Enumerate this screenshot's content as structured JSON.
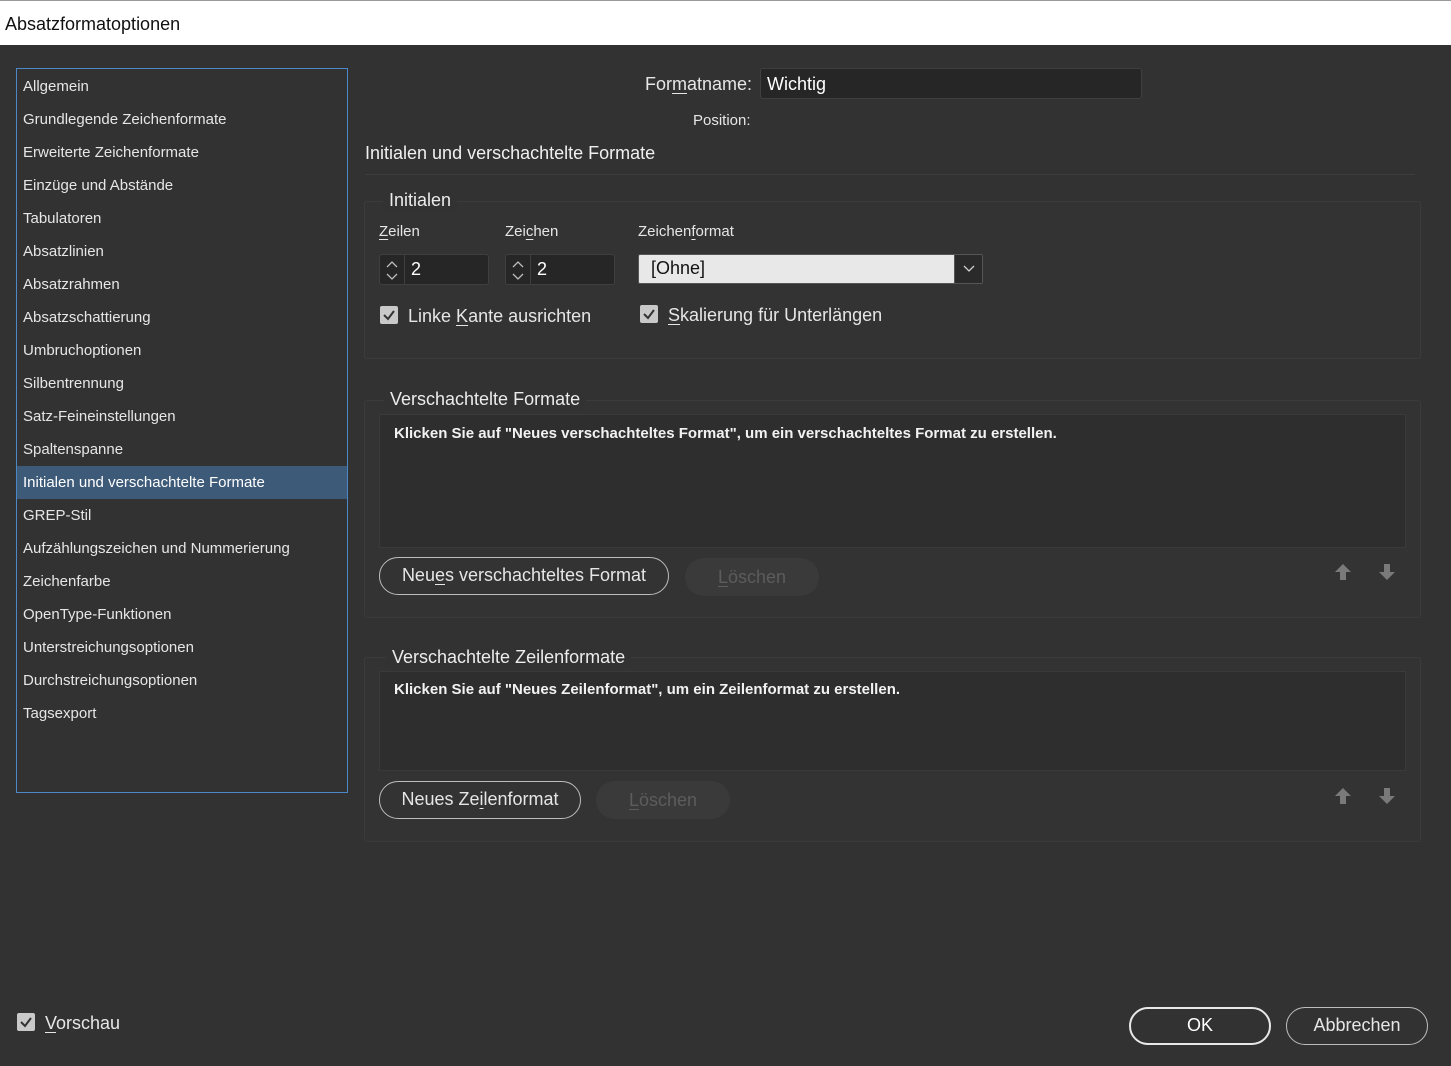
{
  "window": {
    "title": "Absatzformatoptionen"
  },
  "sidebar": {
    "items": [
      {
        "label": "Allgemein"
      },
      {
        "label": "Grundlegende Zeichenformate"
      },
      {
        "label": "Erweiterte Zeichenformate"
      },
      {
        "label": "Einzüge und Abstände"
      },
      {
        "label": "Tabulatoren"
      },
      {
        "label": "Absatzlinien"
      },
      {
        "label": "Absatzrahmen"
      },
      {
        "label": "Absatzschattierung"
      },
      {
        "label": "Umbruchoptionen"
      },
      {
        "label": "Silbentrennung"
      },
      {
        "label": "Satz-Feineinstellungen"
      },
      {
        "label": "Spaltenspanne"
      },
      {
        "label": "Initialen und verschachtelte Formate",
        "selected": true
      },
      {
        "label": "GREP-Stil"
      },
      {
        "label": "Aufzählungszeichen und Nummerierung"
      },
      {
        "label": "Zeichenfarbe"
      },
      {
        "label": "OpenType-Funktionen"
      },
      {
        "label": "Unterstreichungsoptionen"
      },
      {
        "label": "Durchstreichungsoptionen"
      },
      {
        "label": "Tagsexport"
      }
    ]
  },
  "header": {
    "formatname_label_pre": "For",
    "formatname_label_u": "m",
    "formatname_label_post": "atname:",
    "formatname_value": "Wichtig",
    "position_label": "Position:",
    "section_title": "Initialen und verschachtelte Formate"
  },
  "initialen": {
    "title": "Initialen",
    "zeilen_label_u": "Z",
    "zeilen_label_rest": "eilen",
    "zeilen_value": "2",
    "zeichen_label_pre": "Zei",
    "zeichen_label_u": "c",
    "zeichen_label_post": "hen",
    "zeichen_value": "2",
    "zeichenformat_label_pre": "Zeichen",
    "zeichenformat_label_u": "f",
    "zeichenformat_label_post": "ormat",
    "zeichenformat_value": "[Ohne]",
    "linke_kante_pre": "Linke ",
    "linke_kante_u": "K",
    "linke_kante_post": "ante ausrichten",
    "linke_kante_checked": true,
    "skalierung_u": "S",
    "skalierung_post": "kalierung für Unterlängen",
    "skalierung_checked": true
  },
  "verschachtelte_formate": {
    "title": "Verschachtelte Formate",
    "info": "Klicken Sie auf \"Neues verschachteltes Format\", um ein verschachteltes Format zu erstellen.",
    "new_button_pre": "Neu",
    "new_button_u": "e",
    "new_button_post": "s verschachteltes Format",
    "delete_button_u": "L",
    "delete_button_post": "öschen"
  },
  "verschachtelte_zeilenformate": {
    "title": "Verschachtelte Zeilenformate",
    "info": "Klicken Sie auf \"Neues Zeilenformat\", um ein Zeilenformat zu erstellen.",
    "new_button_pre": "Neues Ze",
    "new_button_u": "i",
    "new_button_post": "lenformat",
    "delete_button_u": "L",
    "delete_button_post": "öschen"
  },
  "footer": {
    "vorschau_u": "V",
    "vorschau_post": "orschau",
    "vorschau_checked": true,
    "ok_label": "OK",
    "cancel_label": "Abbrechen"
  },
  "colors": {
    "background": "#323232",
    "selection": "#3d5a78",
    "sidebar_border": "#4b88c8"
  }
}
